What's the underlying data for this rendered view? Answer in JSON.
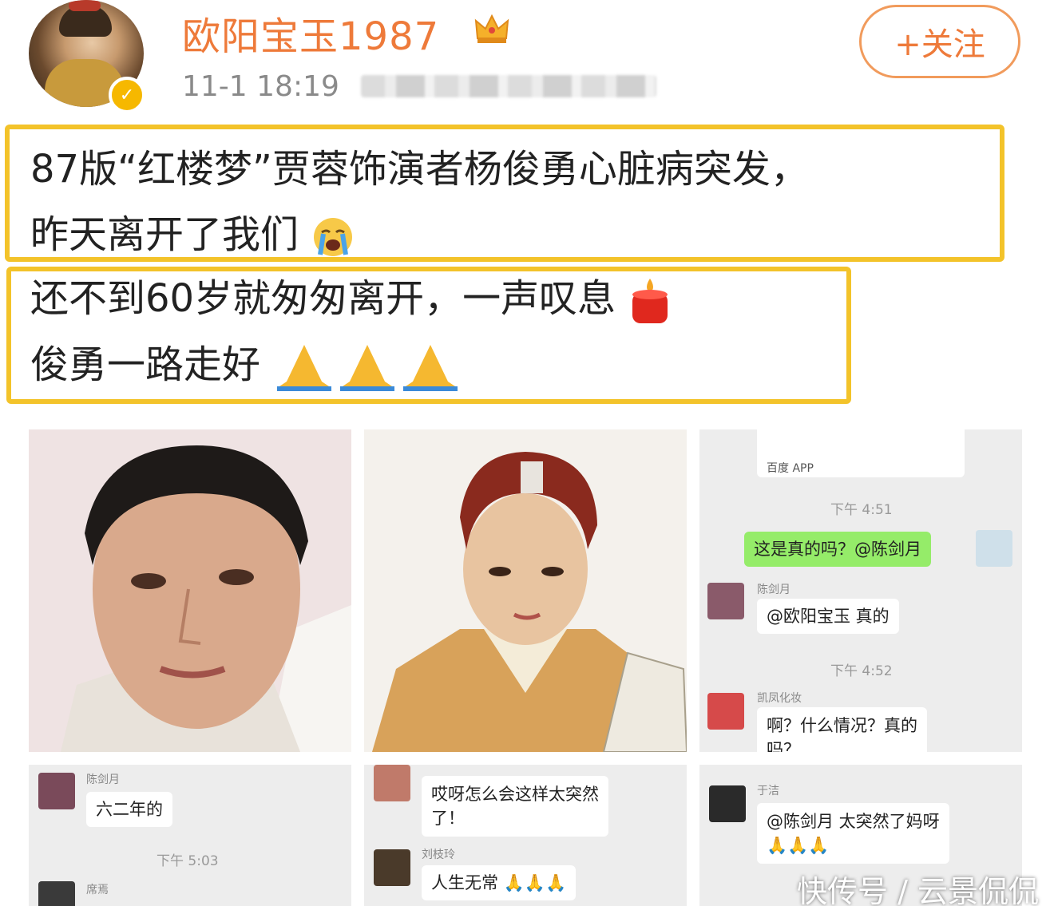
{
  "post": {
    "username": "欧阳宝玉1987",
    "timestamp": "11-1 18:19",
    "follow_label": "+关注",
    "line1": "87版“红楼梦”贾蓉饰演者杨俊勇心脏病突发，",
    "line2": "昨天离开了我们",
    "line3": "还不到60岁就匆匆离开，一声叹息",
    "line4": "俊勇一路走好"
  },
  "grid": {
    "chat1": {
      "app_label": "百度 APP",
      "time1": "下午 4:51",
      "msg_self": "这是真的吗？@陈剑月",
      "name1": "陈剑月",
      "msg1": "@欧阳宝玉 真的",
      "time2": "下午 4:52",
      "name2": "凯凤化妆",
      "msg2a": "啊？什么情况？真的",
      "msg2b": "吗？"
    },
    "chat2": {
      "name1": "陈剑月",
      "msg1": "六二年的",
      "time": "下午 5:03",
      "name2": "席焉"
    },
    "chat3": {
      "msg1a": "哎呀怎么会这样太突然",
      "msg1b": "了！",
      "name2": "刘枝玲",
      "msg2": "人生无常"
    },
    "chat4": {
      "name1": "于洁",
      "msg1": "@陈剑月 太突然了妈呀"
    }
  },
  "watermark": "快传号 / 云景侃侃",
  "colors": {
    "username": "#ee7a3a",
    "highlight_border": "#f3c32a",
    "wechat_green": "#95ec69"
  },
  "icons": [
    "crown-icon",
    "verified-badge-icon",
    "crying-face-icon",
    "candle-icon",
    "folded-hands-icon"
  ]
}
